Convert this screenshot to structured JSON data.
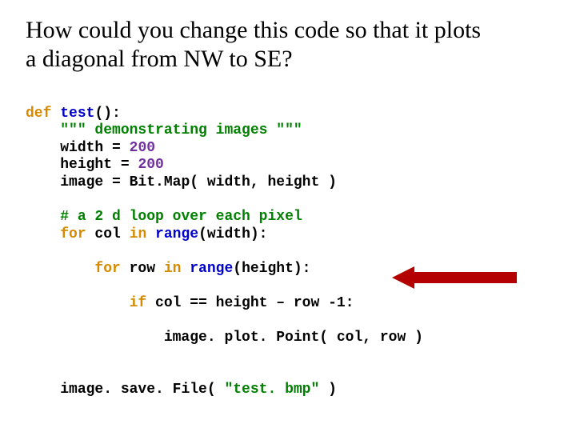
{
  "title_l1": "How could you change this code so that it plots",
  "title_l2": "a diagonal from NW to SE?",
  "code": {
    "kw_def": "def",
    "fn_test": "test",
    "paren_colon": "():",
    "docq1": "\"\"\"",
    "doc_body": " demonstrating images ",
    "docq2": "\"\"\"",
    "assign_w": "width = ",
    "num_200a": "200",
    "assign_h": "height = ",
    "num_200b": "200",
    "assign_img": "image = Bit.Map( width, height )",
    "cmt_loop": "# a 2 d loop over each pixel",
    "kw_for1": "for",
    "id_col": " col ",
    "kw_in1": "in",
    "fn_range1": " range",
    "args_w": "(width):",
    "kw_for2": "for",
    "id_row": " row ",
    "kw_in2": "in",
    "fn_range2": " range",
    "args_h": "(height):",
    "kw_if": "if",
    "cond": " col == height – row -1:",
    "plot": "image. plot. Point( col, row )",
    "save": "image. save. File( ",
    "save_str": "\"test. bmp\"",
    "save_end": " )"
  }
}
